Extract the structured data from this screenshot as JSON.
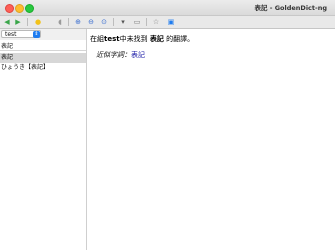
{
  "window": {
    "title": "表記 - GoldenDict-ng"
  },
  "toolbar": {
    "buttons": [
      {
        "name": "back-button",
        "icon": "arrow-left-icon",
        "glyph": "◀",
        "color": "#3aa64a"
      },
      {
        "name": "forward-button",
        "icon": "arrow-right-icon",
        "glyph": "▶",
        "color": "#3aa64a"
      },
      {
        "name": "scan-popup-button",
        "icon": "bulb-icon",
        "glyph": "●",
        "color": "#f2c21a"
      },
      {
        "name": "pronounce-button",
        "icon": "speaker-icon",
        "glyph": "◖",
        "color": "#9a9a9a"
      },
      {
        "name": "zoom-in-button",
        "icon": "zoom-in-icon",
        "glyph": "⊕",
        "color": "#3b6fd0"
      },
      {
        "name": "zoom-out-button",
        "icon": "zoom-out-icon",
        "glyph": "⊖",
        "color": "#3b6fd0"
      },
      {
        "name": "zoom-reset-button",
        "icon": "zoom-reset-icon",
        "glyph": "⊙",
        "color": "#3b6fd0"
      },
      {
        "name": "save-button",
        "icon": "save-icon",
        "glyph": "▾",
        "color": "#555555"
      },
      {
        "name": "print-button",
        "icon": "print-icon",
        "glyph": "▭",
        "color": "#777777"
      },
      {
        "name": "add-favorite-button",
        "icon": "star-icon",
        "glyph": "☆",
        "color": "#777777"
      },
      {
        "name": "dictionary-bar-button",
        "icon": "dictionary-icon",
        "glyph": "▣",
        "color": "#1e7cf0"
      }
    ]
  },
  "leftpane": {
    "group_select": {
      "value": "test"
    },
    "search": {
      "value": "表記"
    },
    "word_list": [
      {
        "label": "表記",
        "selected": true
      },
      {
        "label": "ひょうき【表記】",
        "selected": false
      }
    ]
  },
  "article": {
    "prefix": "在組",
    "group": "test",
    "middle": "中未找到",
    "word": "表記",
    "suffix": "的翻譯。",
    "similar_label": "近似字詞：",
    "similar_word": "表記"
  }
}
